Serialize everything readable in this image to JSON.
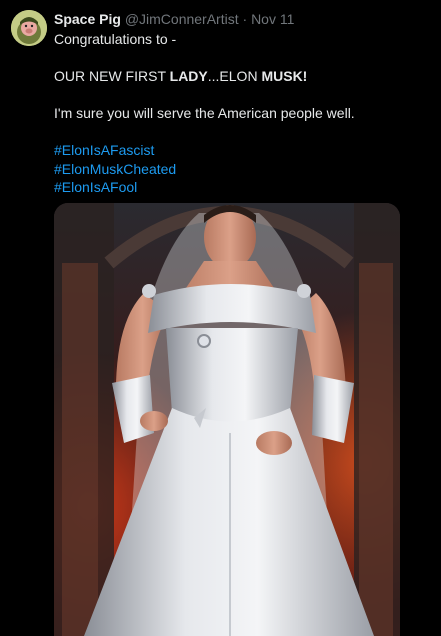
{
  "tweet": {
    "display_name": "Space Pig",
    "handle": "@JimConnerArtist",
    "separator": "·",
    "timestamp": "Nov 11",
    "avatar_icon": "pig-astronaut-avatar",
    "text": {
      "line1": "Congratulations to -",
      "line2_prefix": "OUR NEW FIRST ",
      "line2_bold1": "LADY",
      "line2_mid": "...ELON ",
      "line2_bold2": "MUSK!",
      "line3": "I'm sure you will serve the American people well."
    },
    "hashtags": [
      "#ElonIsAFascist",
      "#ElonMuskCheated",
      "#ElonIsAFool"
    ],
    "media_icon": "ai-generated-image-man-in-white-wedding-gown"
  },
  "colors": {
    "background": "#000000",
    "text": "#e7e9ea",
    "muted": "#71767b",
    "link": "#1d9bf0"
  }
}
